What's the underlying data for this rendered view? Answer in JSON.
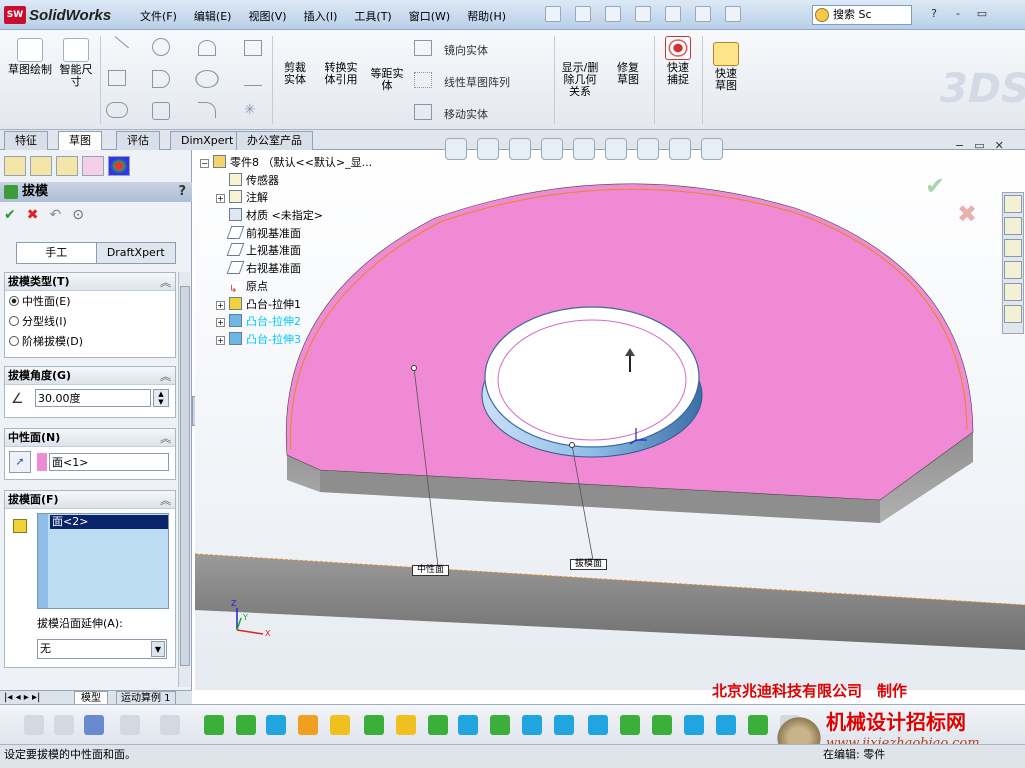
{
  "titlebar": {
    "app_badge": "SW",
    "app_name": "SolidWorks",
    "menus": [
      "文件(F)",
      "编辑(E)",
      "视图(V)",
      "插入(I)",
      "工具(T)",
      "窗口(W)",
      "帮助(H)"
    ],
    "search_placeholder": "搜索 Sc",
    "window_buttons": [
      "?",
      "-",
      "▭"
    ]
  },
  "command_manager": {
    "sketch": "草图绘制",
    "smart_dim": "智能尺寸",
    "trim": "剪裁实体",
    "convert": "转换实体引用",
    "offset": "等距实体",
    "mirror": "镜向实体",
    "linear_pattern": "线性草图阵列",
    "move": "移动实体",
    "display_relations": "显示/删除几何关系",
    "repair": "修复草图",
    "quick_snap": "快速捕捉",
    "rapid_sketch": "快速草图"
  },
  "tabs": [
    "特征",
    "草图",
    "评估",
    "DimXpert",
    "办公室产品"
  ],
  "active_tab": "草图",
  "property_manager": {
    "title": "拔模",
    "help": "?",
    "mode_tabs": [
      "手工",
      "DraftXpert"
    ],
    "draft_type": {
      "header": "拔模类型(T)",
      "options": [
        "中性面(E)",
        "分型线(I)",
        "阶梯拔模(D)"
      ],
      "selected": "中性面(E)"
    },
    "draft_angle": {
      "header": "拔模角度(G)",
      "value": "30.00度"
    },
    "neutral_plane": {
      "header": "中性面(N)",
      "value": "面<1>"
    },
    "draft_faces": {
      "header": "拔模面(F)",
      "items": [
        "面<2>"
      ],
      "propagation_label": "拔模沿面延伸(A):",
      "propagation_value": "无"
    }
  },
  "bottom_tabs": [
    "模型",
    "运动算例 1"
  ],
  "feature_tree": {
    "root": "零件8 （默认<<默认>_显...",
    "items": [
      {
        "label": "传感器",
        "expand": false,
        "color": "normal"
      },
      {
        "label": "注解",
        "expand": true,
        "color": "normal"
      },
      {
        "label": "材质 <未指定>",
        "expand": false,
        "color": "normal"
      },
      {
        "label": "前视基准面",
        "expand": false,
        "color": "normal"
      },
      {
        "label": "上视基准面",
        "expand": false,
        "color": "normal"
      },
      {
        "label": "右视基准面",
        "expand": false,
        "color": "normal"
      },
      {
        "label": "原点",
        "expand": false,
        "color": "normal"
      },
      {
        "label": "凸台-拉伸1",
        "expand": true,
        "color": "normal"
      },
      {
        "label": "凸台-拉伸2",
        "expand": true,
        "color": "cyan"
      },
      {
        "label": "凸台-拉伸3",
        "expand": true,
        "color": "cyan"
      }
    ]
  },
  "callouts": {
    "neutral": "中性面",
    "draft": "拔模面"
  },
  "axis_labels": {
    "x": "X",
    "y": "Y",
    "z": "Z"
  },
  "watermark": {
    "company": "北京兆迪科技有限公司　制作",
    "site_name": "机械设计招标网",
    "url": "www.jixiezhaobiao.com"
  },
  "status": {
    "message": "设定要拔模的中性面和面。",
    "editing": "在编辑: 零件"
  },
  "colors": {
    "face_pink": "#f08ad4",
    "face_blue": "#8fbde8",
    "accent_red": "#e00000"
  }
}
